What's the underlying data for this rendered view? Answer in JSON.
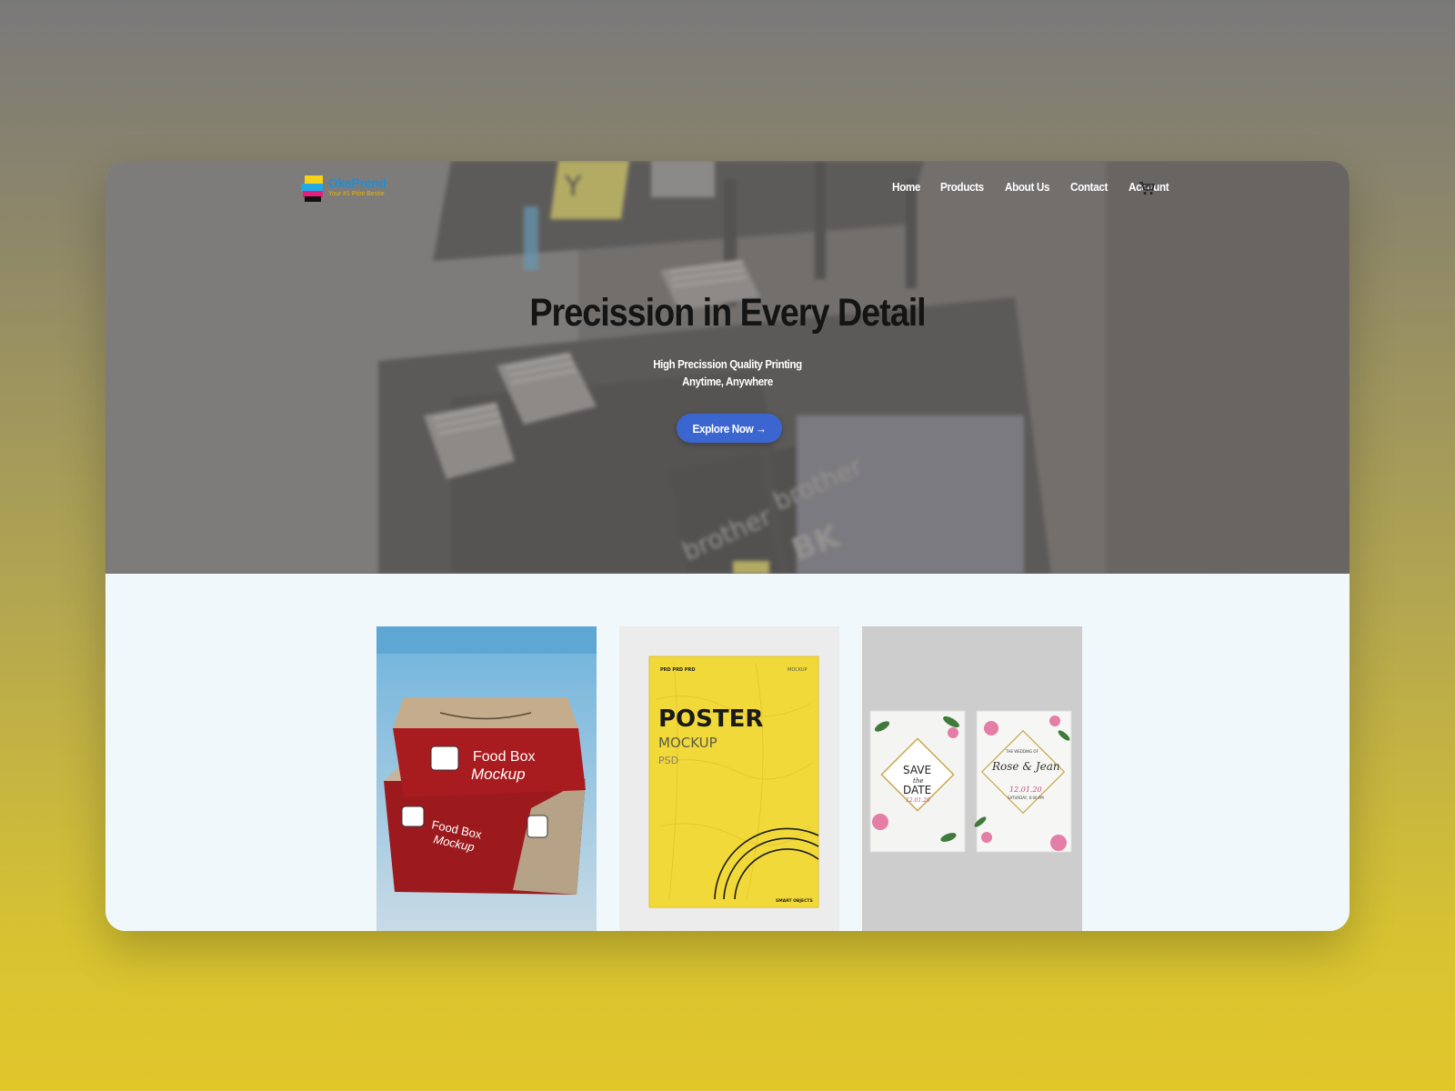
{
  "brand": {
    "name": "OkePrend",
    "tagline": "Your #1 Print Bestie"
  },
  "nav": {
    "items": [
      {
        "label": "Home"
      },
      {
        "label": "Products"
      },
      {
        "label": "About Us"
      },
      {
        "label": "Contact"
      },
      {
        "label": "Account"
      }
    ],
    "cart_icon": "cart-icon"
  },
  "hero": {
    "title": "Precission in Every Detail",
    "subtitle_line1": "High Precission Quality Printing",
    "subtitle_line2": "Anytime, Anywhere",
    "cta_label": "Explore Now →",
    "printer_text": {
      "cartridge_y": "Y",
      "brand_1": "brother",
      "brand_2": "brother",
      "cartridge_bk": "BK"
    }
  },
  "products": [
    {
      "name": "food-box",
      "texts": {
        "line1": "Food Box",
        "line2": "Mockup"
      }
    },
    {
      "name": "poster",
      "texts": {
        "title": "POSTER",
        "sub": "MOCKUP",
        "sub2": "PSD",
        "corner": "MOCKUP",
        "logo": "PRD PRD PRD",
        "footer": "SMART OBJECTS"
      }
    },
    {
      "name": "invitation",
      "texts": {
        "save1": "SAVE",
        "save2": "the",
        "save3": "DATE",
        "save_date": "12.01.20",
        "wedding_of": "THE WEDDING OF",
        "names": "Rose & Jean",
        "wed_date": "12.01.20",
        "wed_time": "SATURDAY, 6:00 PM"
      }
    }
  ],
  "colors": {
    "accent": "#3b66cf",
    "box_red": "#a81b1e",
    "poster_yellow": "#f2d93a",
    "page_bg": "#f1f8fb"
  }
}
